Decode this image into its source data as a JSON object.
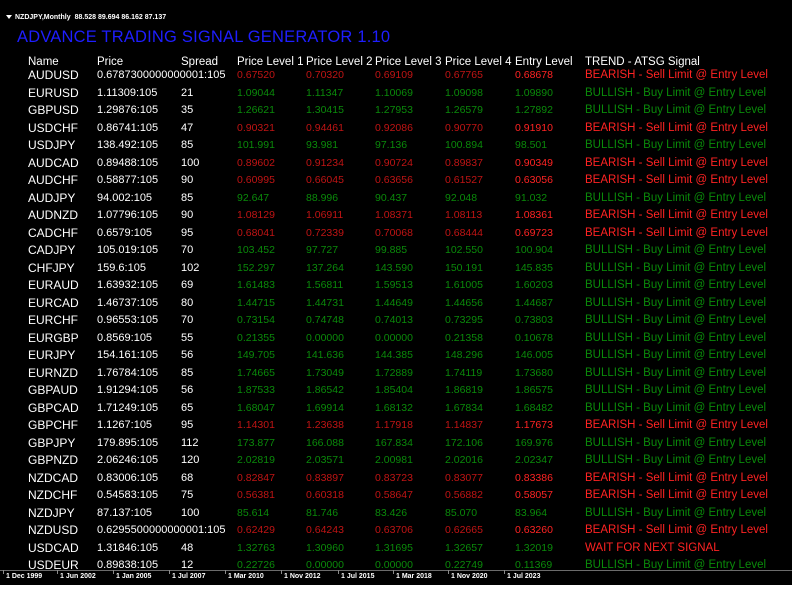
{
  "chart_window": {
    "symbol_timeframe": "NZDJPY,Monthly",
    "ohlc": "88.528 89.694 86.162 87.137"
  },
  "indicator": {
    "title": "ADVANCE TRADING SIGNAL GENERATOR 1.10"
  },
  "colors": {
    "background": "#000000",
    "title": "#1e1eff",
    "bullish": "#18b418",
    "bearish": "#ff2323",
    "text": "#ffffff"
  },
  "table": {
    "headers": {
      "name": "Name",
      "price": "Price",
      "spread": "Spread",
      "level1": "Price Level 1",
      "level2": "Price Level 2",
      "level3": "Price Level 3",
      "level4": "Price Level 4",
      "entry": "Entry Level",
      "trend": "TREND - ATSG Signal"
    },
    "rows": [
      {
        "name": "AUDUSD",
        "price": "0.6787300000000001:105",
        "spread": "",
        "l1": "0.67520",
        "l2": "0.70320",
        "l3": "0.69109",
        "l4": "0.67765",
        "entry": "0.68678",
        "trend": "BEARISH - Sell Limit @ Entry Level",
        "signal": "bearish"
      },
      {
        "name": "EURUSD",
        "price": "1.11309:105",
        "spread": "21",
        "l1": "1.09044",
        "l2": "1.11347",
        "l3": "1.10069",
        "l4": "1.09098",
        "entry": "1.09890",
        "trend": "BULLISH - Buy Limit @ Entry Level",
        "signal": "bullish"
      },
      {
        "name": "GBPUSD",
        "price": "1.29876:105",
        "spread": "35",
        "l1": "1.26621",
        "l2": "1.30415",
        "l3": "1.27953",
        "l4": "1.26579",
        "entry": "1.27892",
        "trend": "BULLISH - Buy Limit @ Entry Level",
        "signal": "bullish"
      },
      {
        "name": "USDCHF",
        "price": "0.86741:105",
        "spread": "47",
        "l1": "0.90321",
        "l2": "0.94461",
        "l3": "0.92086",
        "l4": "0.90770",
        "entry": "0.91910",
        "trend": "BEARISH - Sell Limit @ Entry Level",
        "signal": "bearish"
      },
      {
        "name": "USDJPY",
        "price": "138.492:105",
        "spread": "85",
        "l1": "101.991",
        "l2": "93.981",
        "l3": "97.136",
        "l4": "100.894",
        "entry": "98.501",
        "trend": "BULLISH - Buy Limit @ Entry Level",
        "signal": "bullish"
      },
      {
        "name": "AUDCAD",
        "price": "0.89488:105",
        "spread": "100",
        "l1": "0.89602",
        "l2": "0.91234",
        "l3": "0.90724",
        "l4": "0.89837",
        "entry": "0.90349",
        "trend": "BEARISH - Sell Limit @ Entry Level",
        "signal": "bearish"
      },
      {
        "name": "AUDCHF",
        "price": "0.58877:105",
        "spread": "90",
        "l1": "0.60995",
        "l2": "0.66045",
        "l3": "0.63656",
        "l4": "0.61527",
        "entry": "0.63056",
        "trend": "BEARISH - Sell Limit @ Entry Level",
        "signal": "bearish"
      },
      {
        "name": "AUDJPY",
        "price": "94.002:105",
        "spread": "85",
        "l1": "92.647",
        "l2": "88.996",
        "l3": "90.437",
        "l4": "92.048",
        "entry": "91.032",
        "trend": "BULLISH - Buy Limit @ Entry Level",
        "signal": "bullish"
      },
      {
        "name": "AUDNZD",
        "price": "1.07796:105",
        "spread": "90",
        "l1": "1.08129",
        "l2": "1.06911",
        "l3": "1.08371",
        "l4": "1.08113",
        "entry": "1.08361",
        "trend": "BEARISH - Sell Limit @ Entry Level",
        "signal": "bearish"
      },
      {
        "name": "CADCHF",
        "price": "0.6579:105",
        "spread": "95",
        "l1": "0.68041",
        "l2": "0.72339",
        "l3": "0.70068",
        "l4": "0.68444",
        "entry": "0.69723",
        "trend": "BEARISH - Sell Limit @ Entry Level",
        "signal": "bearish"
      },
      {
        "name": "CADJPY",
        "price": "105.019:105",
        "spread": "70",
        "l1": "103.452",
        "l2": "97.727",
        "l3": "99.885",
        "l4": "102.550",
        "entry": "100.904",
        "trend": "BULLISH - Buy Limit @ Entry Level",
        "signal": "bullish"
      },
      {
        "name": "CHFJPY",
        "price": "159.6:105",
        "spread": "102",
        "l1": "152.297",
        "l2": "137.264",
        "l3": "143.590",
        "l4": "150.191",
        "entry": "145.835",
        "trend": "BULLISH - Buy Limit @ Entry Level",
        "signal": "bullish"
      },
      {
        "name": "EURAUD",
        "price": "1.63932:105",
        "spread": "69",
        "l1": "1.61483",
        "l2": "1.56811",
        "l3": "1.59513",
        "l4": "1.61005",
        "entry": "1.60203",
        "trend": "BULLISH - Buy Limit @ Entry Level",
        "signal": "bullish"
      },
      {
        "name": "EURCAD",
        "price": "1.46737:105",
        "spread": "80",
        "l1": "1.44715",
        "l2": "1.44731",
        "l3": "1.44649",
        "l4": "1.44656",
        "entry": "1.44687",
        "trend": "BULLISH - Buy Limit @ Entry Level",
        "signal": "bullish"
      },
      {
        "name": "EURCHF",
        "price": "0.96553:105",
        "spread": "70",
        "l1": "0.73154",
        "l2": "0.74748",
        "l3": "0.74013",
        "l4": "0.73295",
        "entry": "0.73803",
        "trend": "BULLISH - Buy Limit @ Entry Level",
        "signal": "bullish"
      },
      {
        "name": "EURGBP",
        "price": "0.8569:105",
        "spread": "55",
        "l1": "0.21355",
        "l2": "0.00000",
        "l3": "0.00000",
        "l4": "0.21358",
        "entry": "0.10678",
        "trend": "BULLISH - Buy Limit @ Entry Level",
        "signal": "bullish"
      },
      {
        "name": "EURJPY",
        "price": "154.161:105",
        "spread": "56",
        "l1": "149.705",
        "l2": "141.636",
        "l3": "144.385",
        "l4": "148.296",
        "entry": "146.005",
        "trend": "BULLISH - Buy Limit @ Entry Level",
        "signal": "bullish"
      },
      {
        "name": "EURNZD",
        "price": "1.76784:105",
        "spread": "85",
        "l1": "1.74665",
        "l2": "1.73049",
        "l3": "1.72889",
        "l4": "1.74119",
        "entry": "1.73680",
        "trend": "BULLISH - Buy Limit @ Entry Level",
        "signal": "bullish"
      },
      {
        "name": "GBPAUD",
        "price": "1.91294:105",
        "spread": "56",
        "l1": "1.87533",
        "l2": "1.86542",
        "l3": "1.85404",
        "l4": "1.86819",
        "entry": "1.86575",
        "trend": "BULLISH - Buy Limit @ Entry Level",
        "signal": "bullish"
      },
      {
        "name": "GBPCAD",
        "price": "1.71249:105",
        "spread": "65",
        "l1": "1.68047",
        "l2": "1.69914",
        "l3": "1.68132",
        "l4": "1.67834",
        "entry": "1.68482",
        "trend": "BULLISH - Buy Limit @ Entry Level",
        "signal": "bullish"
      },
      {
        "name": "GBPCHF",
        "price": "1.1267:105",
        "spread": "95",
        "l1": "1.14301",
        "l2": "1.23638",
        "l3": "1.17918",
        "l4": "1.14837",
        "entry": "1.17673",
        "trend": "BEARISH - Sell Limit @ Entry Level",
        "signal": "bearish"
      },
      {
        "name": "GBPJPY",
        "price": "179.895:105",
        "spread": "112",
        "l1": "173.877",
        "l2": "166.088",
        "l3": "167.834",
        "l4": "172.106",
        "entry": "169.976",
        "trend": "BULLISH - Buy Limit @ Entry Level",
        "signal": "bullish"
      },
      {
        "name": "GBPNZD",
        "price": "2.06246:105",
        "spread": "120",
        "l1": "2.02819",
        "l2": "2.03571",
        "l3": "2.00981",
        "l4": "2.02016",
        "entry": "2.02347",
        "trend": "BULLISH - Buy Limit @ Entry Level",
        "signal": "bullish"
      },
      {
        "name": "NZDCAD",
        "price": "0.83006:105",
        "spread": "68",
        "l1": "0.82847",
        "l2": "0.83897",
        "l3": "0.83723",
        "l4": "0.83077",
        "entry": "0.83386",
        "trend": "BEARISH - Sell Limit @ Entry Level",
        "signal": "bearish"
      },
      {
        "name": "NZDCHF",
        "price": "0.54583:105",
        "spread": "75",
        "l1": "0.56381",
        "l2": "0.60318",
        "l3": "0.58647",
        "l4": "0.56882",
        "entry": "0.58057",
        "trend": "BEARISH - Sell Limit @ Entry Level",
        "signal": "bearish"
      },
      {
        "name": "NZDJPY",
        "price": "87.137:105",
        "spread": "100",
        "l1": "85.614",
        "l2": "81.746",
        "l3": "83.426",
        "l4": "85.070",
        "entry": "83.964",
        "trend": "BULLISH - Buy Limit @ Entry Level",
        "signal": "bullish"
      },
      {
        "name": "NZDUSD",
        "price": "0.6295500000000001:105",
        "spread": "",
        "l1": "0.62429",
        "l2": "0.64243",
        "l3": "0.63706",
        "l4": "0.62665",
        "entry": "0.63260",
        "trend": "BEARISH - Sell Limit @ Entry Level",
        "signal": "bearish"
      },
      {
        "name": "USDCAD",
        "price": "1.31846:105",
        "spread": "48",
        "l1": "1.32763",
        "l2": "1.30960",
        "l3": "1.31695",
        "l4": "1.32657",
        "entry": "1.32019",
        "trend": "WAIT FOR NEXT SIGNAL",
        "signal": "wait"
      },
      {
        "name": "USDEUR",
        "price": "0.89838:105",
        "spread": "12",
        "l1": "0.22726",
        "l2": "0.00000",
        "l3": "0.00000",
        "l4": "0.22749",
        "entry": "0.11369",
        "trend": "BULLISH - Buy Limit @ Entry Level",
        "signal": "bullish"
      }
    ]
  },
  "time_axis": {
    "labels": [
      "1 Dec 1999",
      "1 Jun 2002",
      "1 Jan 2005",
      "1 Jul 2007",
      "1 Mar 2010",
      "1 Nov 2012",
      "1 Jul 2015",
      "1 Mar 2018",
      "1 Nov 2020",
      "1 Jul 2023"
    ]
  }
}
